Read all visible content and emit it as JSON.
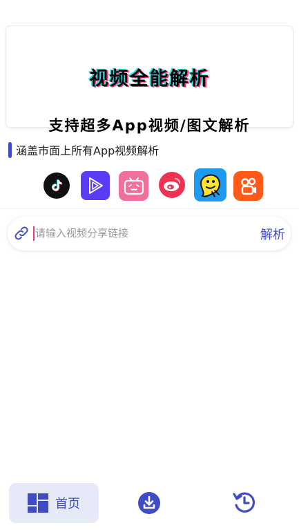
{
  "banner": {
    "title": "视频全能解析",
    "subtitle": "支持超多App视频/图文解析"
  },
  "section": {
    "heading": "涵盖市面上所有App视频解析"
  },
  "platforms": [
    {
      "name": "douyin-icon"
    },
    {
      "name": "video-play-icon"
    },
    {
      "name": "bilibili-icon"
    },
    {
      "name": "weibo-icon"
    },
    {
      "name": "pipixia-icon"
    },
    {
      "name": "kuaishou-icon"
    }
  ],
  "search": {
    "placeholder": "请输入视频分享链接",
    "value": "",
    "button_label": "解析"
  },
  "tabbar": {
    "home_label": "首页"
  },
  "colors": {
    "accent": "#3f4cc4",
    "accent_bg": "#e6e9f7",
    "cursor": "#ee3a6a"
  }
}
